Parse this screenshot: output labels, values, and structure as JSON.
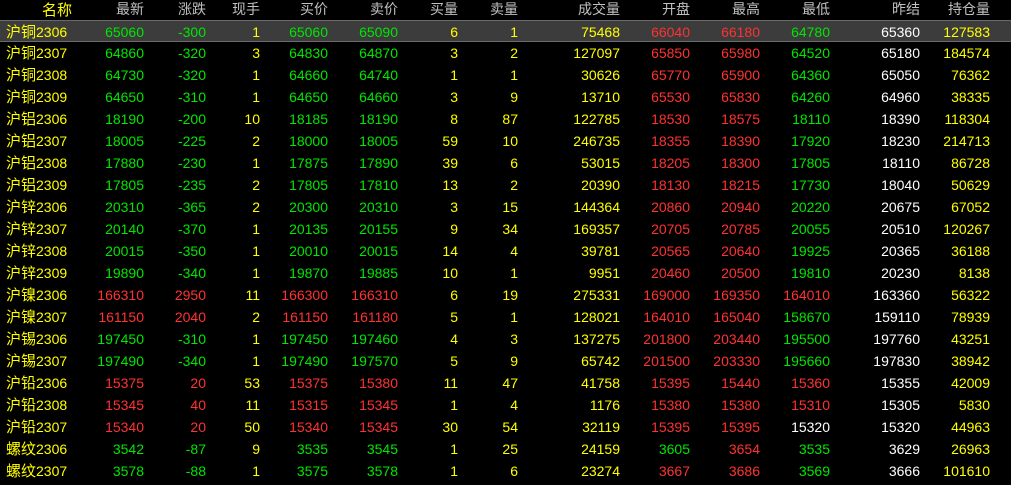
{
  "colors": {
    "up": "#ff3232",
    "down": "#00e600",
    "flat": "#ffffff",
    "volume": "#ffff00",
    "header": "#c0c0c0",
    "name": "#ffff00",
    "background": "#000000"
  },
  "headers": [
    "名称",
    "最新",
    "涨跌",
    "现手",
    "买价",
    "卖价",
    "买量",
    "卖量",
    "成交量",
    "开盘",
    "最高",
    "最低",
    "昨结",
    "持仓量"
  ],
  "rows": [
    {
      "name": "沪铜",
      "code": "2306",
      "last": "65060",
      "change": "-300",
      "hand": "1",
      "bid": "65060",
      "ask": "65090",
      "bid_vol": "6",
      "ask_vol": "1",
      "volume": "75468",
      "open": "66040",
      "high": "66180",
      "low": "64780",
      "prev_settle": "65360",
      "open_interest": "127583",
      "selected": true
    },
    {
      "name": "沪铜",
      "code": "2307",
      "last": "64860",
      "change": "-320",
      "hand": "3",
      "bid": "64830",
      "ask": "64870",
      "bid_vol": "3",
      "ask_vol": "2",
      "volume": "127097",
      "open": "65850",
      "high": "65980",
      "low": "64520",
      "prev_settle": "65180",
      "open_interest": "184574"
    },
    {
      "name": "沪铜",
      "code": "2308",
      "last": "64730",
      "change": "-320",
      "hand": "1",
      "bid": "64660",
      "ask": "64740",
      "bid_vol": "1",
      "ask_vol": "1",
      "volume": "30626",
      "open": "65770",
      "high": "65900",
      "low": "64360",
      "prev_settle": "65050",
      "open_interest": "76362"
    },
    {
      "name": "沪铜",
      "code": "2309",
      "last": "64650",
      "change": "-310",
      "hand": "1",
      "bid": "64650",
      "ask": "64660",
      "bid_vol": "3",
      "ask_vol": "9",
      "volume": "13710",
      "open": "65530",
      "high": "65830",
      "low": "64260",
      "prev_settle": "64960",
      "open_interest": "38335"
    },
    {
      "name": "沪铝",
      "code": "2306",
      "last": "18190",
      "change": "-200",
      "hand": "10",
      "bid": "18185",
      "ask": "18190",
      "bid_vol": "8",
      "ask_vol": "87",
      "volume": "122785",
      "open": "18530",
      "high": "18575",
      "low": "18110",
      "prev_settle": "18390",
      "open_interest": "118304"
    },
    {
      "name": "沪铝",
      "code": "2307",
      "last": "18005",
      "change": "-225",
      "hand": "2",
      "bid": "18000",
      "ask": "18005",
      "bid_vol": "59",
      "ask_vol": "10",
      "volume": "246735",
      "open": "18355",
      "high": "18390",
      "low": "17920",
      "prev_settle": "18230",
      "open_interest": "214713"
    },
    {
      "name": "沪铝",
      "code": "2308",
      "last": "17880",
      "change": "-230",
      "hand": "1",
      "bid": "17875",
      "ask": "17890",
      "bid_vol": "39",
      "ask_vol": "6",
      "volume": "53015",
      "open": "18205",
      "high": "18300",
      "low": "17805",
      "prev_settle": "18110",
      "open_interest": "86728"
    },
    {
      "name": "沪铝",
      "code": "2309",
      "last": "17805",
      "change": "-235",
      "hand": "2",
      "bid": "17805",
      "ask": "17810",
      "bid_vol": "13",
      "ask_vol": "2",
      "volume": "20390",
      "open": "18130",
      "high": "18215",
      "low": "17730",
      "prev_settle": "18040",
      "open_interest": "50629"
    },
    {
      "name": "沪锌",
      "code": "2306",
      "last": "20310",
      "change": "-365",
      "hand": "2",
      "bid": "20300",
      "ask": "20310",
      "bid_vol": "3",
      "ask_vol": "15",
      "volume": "144364",
      "open": "20860",
      "high": "20940",
      "low": "20220",
      "prev_settle": "20675",
      "open_interest": "67052"
    },
    {
      "name": "沪锌",
      "code": "2307",
      "last": "20140",
      "change": "-370",
      "hand": "1",
      "bid": "20135",
      "ask": "20155",
      "bid_vol": "9",
      "ask_vol": "34",
      "volume": "169357",
      "open": "20705",
      "high": "20785",
      "low": "20055",
      "prev_settle": "20510",
      "open_interest": "120267"
    },
    {
      "name": "沪锌",
      "code": "2308",
      "last": "20015",
      "change": "-350",
      "hand": "1",
      "bid": "20010",
      "ask": "20015",
      "bid_vol": "14",
      "ask_vol": "4",
      "volume": "39781",
      "open": "20565",
      "high": "20640",
      "low": "19925",
      "prev_settle": "20365",
      "open_interest": "36188"
    },
    {
      "name": "沪锌",
      "code": "2309",
      "last": "19890",
      "change": "-340",
      "hand": "1",
      "bid": "19870",
      "ask": "19885",
      "bid_vol": "10",
      "ask_vol": "1",
      "volume": "9951",
      "open": "20460",
      "high": "20500",
      "low": "19810",
      "prev_settle": "20230",
      "open_interest": "8138"
    },
    {
      "name": "沪镍",
      "code": "2306",
      "last": "166310",
      "change": "2950",
      "hand": "11",
      "bid": "166300",
      "ask": "166310",
      "bid_vol": "6",
      "ask_vol": "19",
      "volume": "275331",
      "open": "169000",
      "high": "169350",
      "low": "164010",
      "prev_settle": "163360",
      "open_interest": "56322"
    },
    {
      "name": "沪镍",
      "code": "2307",
      "last": "161150",
      "change": "2040",
      "hand": "2",
      "bid": "161150",
      "ask": "161180",
      "bid_vol": "5",
      "ask_vol": "1",
      "volume": "128021",
      "open": "164010",
      "high": "165040",
      "low": "158670",
      "prev_settle": "159110",
      "open_interest": "78939"
    },
    {
      "name": "沪锡",
      "code": "2306",
      "last": "197450",
      "change": "-310",
      "hand": "1",
      "bid": "197450",
      "ask": "197460",
      "bid_vol": "4",
      "ask_vol": "3",
      "volume": "137275",
      "open": "201800",
      "high": "203440",
      "low": "195500",
      "prev_settle": "197760",
      "open_interest": "43251"
    },
    {
      "name": "沪锡",
      "code": "2307",
      "last": "197490",
      "change": "-340",
      "hand": "1",
      "bid": "197490",
      "ask": "197570",
      "bid_vol": "5",
      "ask_vol": "9",
      "volume": "65742",
      "open": "201500",
      "high": "203330",
      "low": "195660",
      "prev_settle": "197830",
      "open_interest": "38942"
    },
    {
      "name": "沪铅",
      "code": "2306",
      "last": "15375",
      "change": "20",
      "hand": "53",
      "bid": "15375",
      "ask": "15380",
      "bid_vol": "11",
      "ask_vol": "47",
      "volume": "41758",
      "open": "15395",
      "high": "15440",
      "low": "15360",
      "prev_settle": "15355",
      "open_interest": "42009"
    },
    {
      "name": "沪铅",
      "code": "2308",
      "last": "15345",
      "change": "40",
      "hand": "11",
      "bid": "15315",
      "ask": "15345",
      "bid_vol": "1",
      "ask_vol": "4",
      "volume": "1176",
      "open": "15380",
      "high": "15380",
      "low": "15310",
      "prev_settle": "15305",
      "open_interest": "5830"
    },
    {
      "name": "沪铅",
      "code": "2307",
      "last": "15340",
      "change": "20",
      "hand": "50",
      "bid": "15340",
      "ask": "15345",
      "bid_vol": "30",
      "ask_vol": "54",
      "volume": "32119",
      "open": "15395",
      "high": "15395",
      "low": "15320",
      "prev_settle": "15320",
      "open_interest": "44963"
    },
    {
      "name": "螺纹",
      "code": "2306",
      "last": "3542",
      "change": "-87",
      "hand": "9",
      "bid": "3535",
      "ask": "3545",
      "bid_vol": "1",
      "ask_vol": "25",
      "volume": "24159",
      "open": "3605",
      "high": "3654",
      "low": "3535",
      "prev_settle": "3629",
      "open_interest": "26963"
    },
    {
      "name": "螺纹",
      "code": "2307",
      "last": "3578",
      "change": "-88",
      "hand": "1",
      "bid": "3575",
      "ask": "3578",
      "bid_vol": "1",
      "ask_vol": "6",
      "volume": "23274",
      "open": "3667",
      "high": "3686",
      "low": "3569",
      "prev_settle": "3666",
      "open_interest": "101610"
    }
  ]
}
